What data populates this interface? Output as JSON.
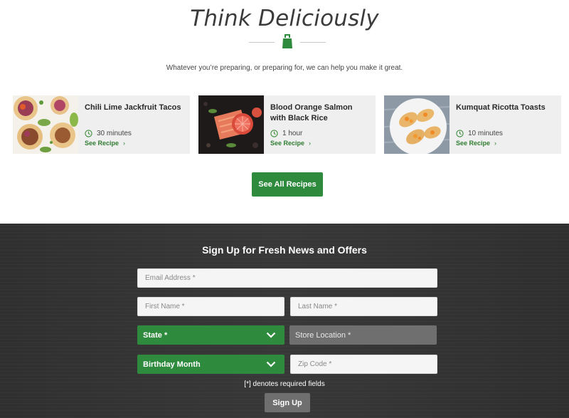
{
  "hero": {
    "headline": "Think Deliciously",
    "tagline": "Whatever you’re preparing, or preparing for, we can help you make it great.",
    "divider_icon": "apron-icon"
  },
  "recipes": [
    {
      "title": "Chili Lime Jackfruit Tacos",
      "time": "30 minutes",
      "link": "See Recipe"
    },
    {
      "title": "Blood Orange Salmon with Black Rice",
      "time": "1 hour",
      "link": "See Recipe"
    },
    {
      "title": "Kumquat Ricotta Toasts",
      "time": "10 minutes",
      "link": "See Recipe"
    }
  ],
  "see_all_label": "See All Recipes",
  "signup": {
    "title": "Sign Up for Fresh News and Offers",
    "email_placeholder": "Email Address *",
    "first_name_placeholder": "First Name *",
    "last_name_placeholder": "Last Name *",
    "state_label": "State *",
    "store_label": "Store Location *",
    "birthday_label": "Birthday Month",
    "zip_placeholder": "Zip Code *",
    "required_note": "[*] denotes required fields",
    "submit_label": "Sign Up"
  },
  "colors": {
    "brand_green": "#2e8b3d",
    "link_green": "#2f7d32",
    "dark_bg": "#333333",
    "card_bg": "#efefef",
    "disabled_gray": "#6f6f6f"
  }
}
